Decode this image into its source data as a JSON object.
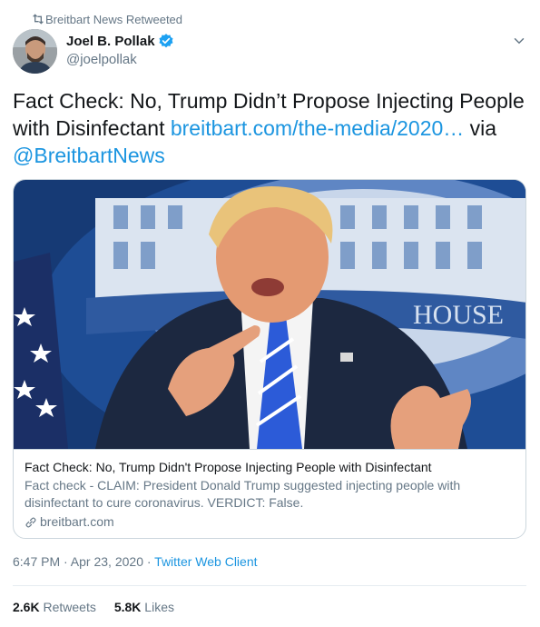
{
  "retweet_context": {
    "icon": "retweet-icon",
    "label": "Breitbart News Retweeted"
  },
  "author": {
    "display_name": "Joel B. Pollak",
    "handle": "@joelpollak",
    "verified_icon": "verified-badge-icon"
  },
  "tweet": {
    "text_plain": "Fact Check: No, Trump Didn’t Propose Injecting People with Disinfectant ",
    "link_text": "breitbart.com/the-media/2020…",
    "text_via": " via ",
    "mention": "@BreitbartNews"
  },
  "card": {
    "title": "Fact Check: No, Trump Didn't Propose Injecting People with Disinfectant",
    "description": "Fact check - CLAIM: President Donald Trump suggested injecting people with disinfectant to cure coronavirus. VERDICT: False.",
    "domain": "breitbart.com",
    "image_sign_text": "HOUSE"
  },
  "meta": {
    "time": "6:47 PM · Apr 23, 2020 · ",
    "client": "Twitter Web Client"
  },
  "stats": {
    "retweets_count": "2.6K",
    "retweets_label": "Retweets",
    "likes_count": "5.8K",
    "likes_label": "Likes"
  },
  "colors": {
    "link": "#1b95e0",
    "secondary": "#657786",
    "border": "#ccd6dd"
  }
}
